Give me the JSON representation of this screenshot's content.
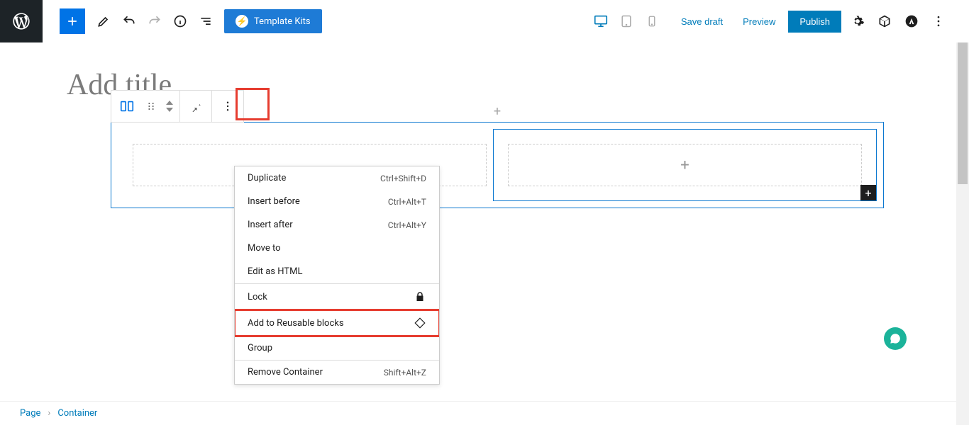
{
  "header": {
    "template_kits_label": "Template Kits",
    "save_draft": "Save draft",
    "preview": "Preview",
    "publish": "Publish"
  },
  "title_placeholder": "Add title",
  "menu": {
    "duplicate": "Duplicate",
    "duplicate_shortcut": "Ctrl+Shift+D",
    "insert_before": "Insert before",
    "insert_before_shortcut": "Ctrl+Alt+T",
    "insert_after": "Insert after",
    "insert_after_shortcut": "Ctrl+Alt+Y",
    "move_to": "Move to",
    "edit_html": "Edit as HTML",
    "lock": "Lock",
    "add_reusable": "Add to Reusable blocks",
    "group": "Group",
    "remove": "Remove Container",
    "remove_shortcut": "Shift+Alt+Z"
  },
  "breadcrumb": {
    "root": "Page",
    "current": "Container"
  }
}
